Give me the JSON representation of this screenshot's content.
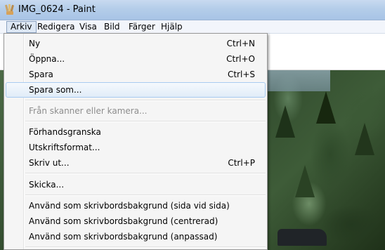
{
  "window": {
    "title": "IMG_0624 - Paint",
    "icon": "paint-icon"
  },
  "menubar": {
    "items": [
      {
        "label": "Arkiv"
      },
      {
        "label": "Redigera"
      },
      {
        "label": "Visa"
      },
      {
        "label": "Bild"
      },
      {
        "label": "Färger"
      },
      {
        "label": "Hjälp"
      }
    ]
  },
  "file_menu": {
    "items": [
      {
        "label": "Ny",
        "shortcut": "Ctrl+N"
      },
      {
        "label": "Öppna...",
        "shortcut": "Ctrl+O"
      },
      {
        "label": "Spara",
        "shortcut": "Ctrl+S"
      },
      {
        "label": "Spara som...",
        "shortcut": ""
      },
      {
        "label": "Från skanner eller kamera...",
        "shortcut": ""
      },
      {
        "label": "Förhandsgranska",
        "shortcut": ""
      },
      {
        "label": "Utskriftsformat...",
        "shortcut": ""
      },
      {
        "label": "Skriv ut...",
        "shortcut": "Ctrl+P"
      },
      {
        "label": "Skicka...",
        "shortcut": ""
      },
      {
        "label": "Använd som skrivbordsbakgrund (sida vid sida)",
        "shortcut": ""
      },
      {
        "label": "Använd som skrivbordsbakgrund (centrerad)",
        "shortcut": ""
      },
      {
        "label": "Använd som skrivbordsbakgrund (anpassad)",
        "shortcut": ""
      }
    ]
  },
  "colors": {
    "highlight_border": "#a8cbf0",
    "disabled_text": "#8d8d8d",
    "menu_bg": "#f5f5f5"
  }
}
